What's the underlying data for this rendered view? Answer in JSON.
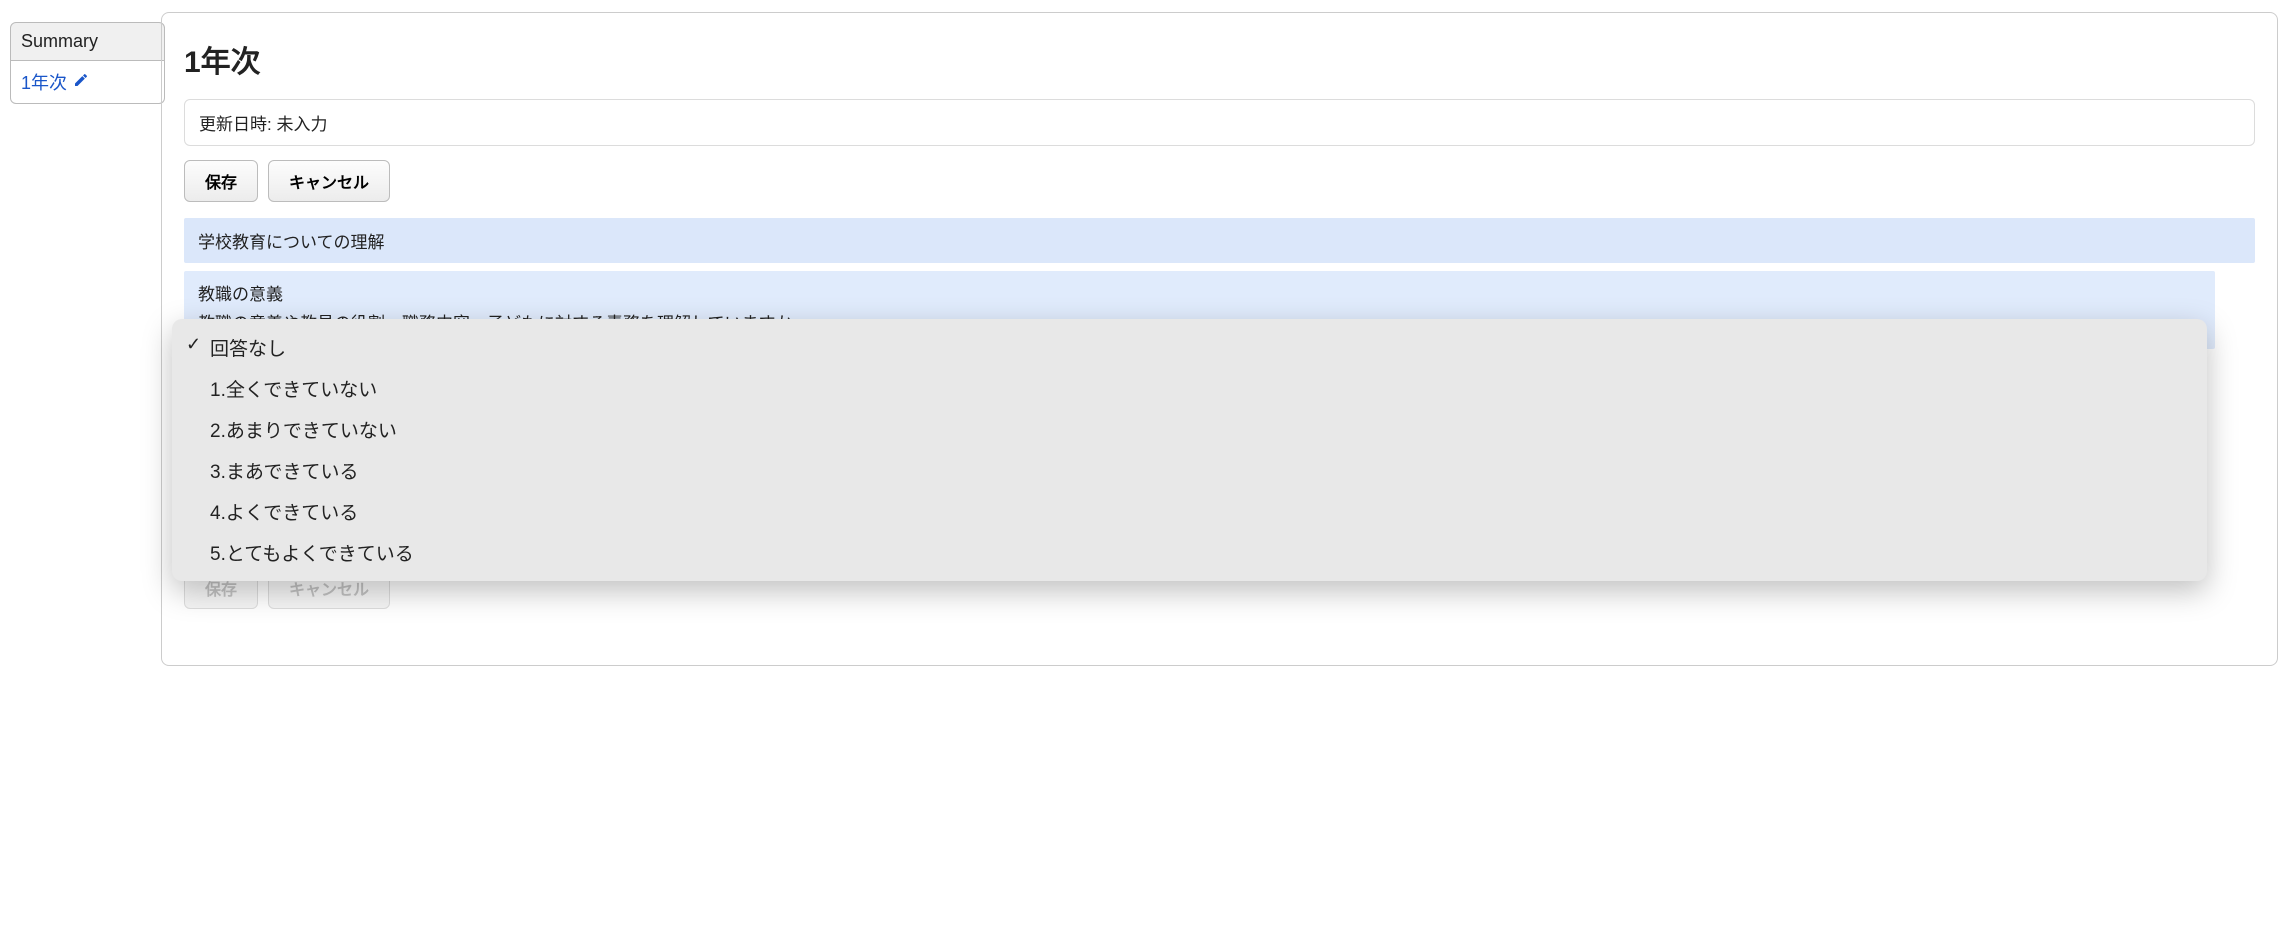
{
  "sidebar": {
    "summary": "Summary",
    "year1": "1年次"
  },
  "header": {
    "title": "1年次",
    "timestamp_label": "更新日時: 未入力",
    "save_label": "保存",
    "cancel_label": "キャンセル"
  },
  "section1": {
    "heading": "学校教育についての理解",
    "question_title": "教職の意義",
    "question_body": "教職の意義や教員の役割、職務内容、子どもに対する責務を理解していますか。"
  },
  "dropdown": {
    "options": [
      "回答なし",
      "1.全くできていない",
      "2.あまりできていない",
      "3.まあできている",
      "4.よくできている",
      "5.とてもよくできている"
    ],
    "selected_index": 0
  },
  "footer": {
    "save_label": "保存",
    "cancel_label": "キャンセル"
  }
}
